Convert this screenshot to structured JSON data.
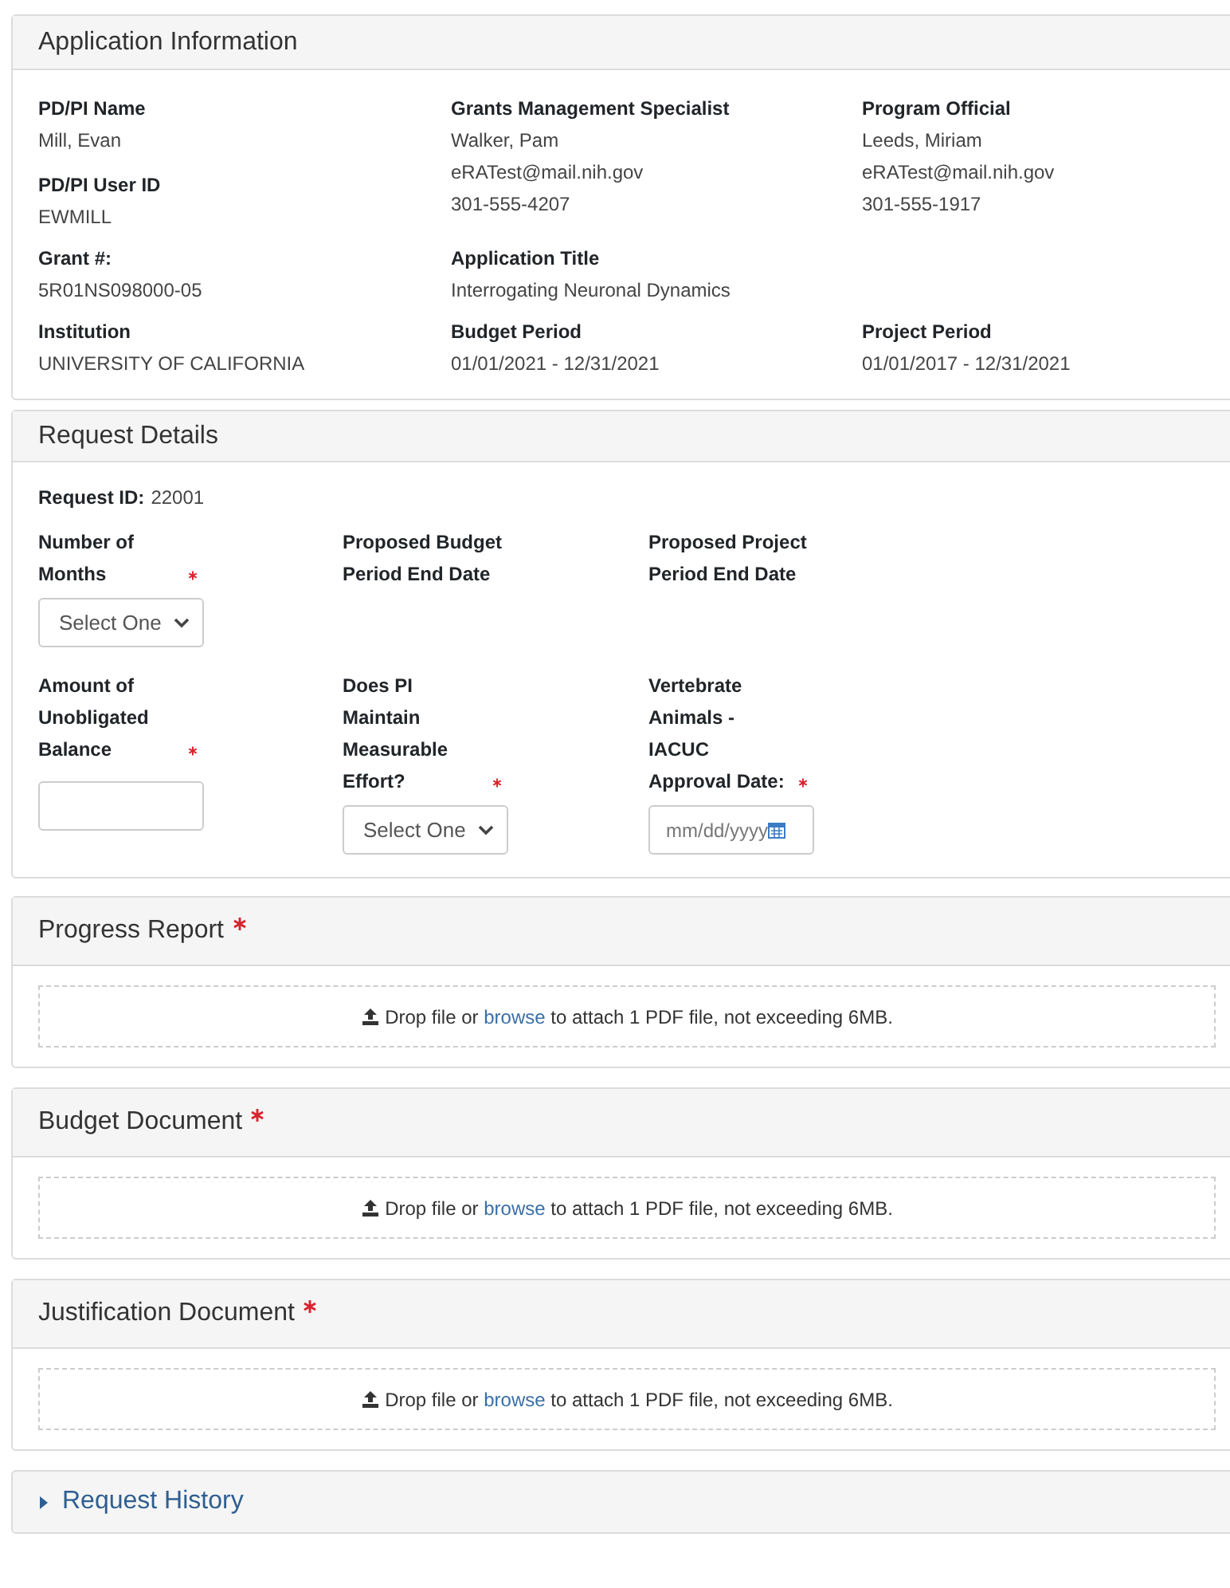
{
  "application_information": {
    "title": "Application Information",
    "rows": [
      [
        [
          {
            "label": "PD/PI Name",
            "values": [
              "Mill, Evan"
            ]
          },
          {
            "label": "PD/PI User ID",
            "values": [
              "EWMILL"
            ]
          }
        ],
        [
          {
            "label": "Grants Management Specialist",
            "values": [
              "Walker, Pam",
              "eRATest@mail.nih.gov",
              "301-555-4207"
            ]
          }
        ],
        [
          {
            "label": "Program Official",
            "values": [
              "Leeds, Miriam",
              "eRATest@mail.nih.gov",
              "301-555-1917"
            ]
          }
        ]
      ],
      [
        [
          {
            "label": "Grant #:",
            "values": [
              "5R01NS098000-05"
            ]
          }
        ],
        [
          {
            "label": "Application Title",
            "values": [
              "Interrogating Neuronal Dynamics"
            ]
          }
        ],
        []
      ],
      [
        [
          {
            "label": "Institution",
            "values": [
              "UNIVERSITY OF CALIFORNIA"
            ]
          }
        ],
        [
          {
            "label": "Budget Period",
            "values": [
              "01/01/2021 - 12/31/2021"
            ]
          }
        ],
        [
          {
            "label": "Project Period",
            "values": [
              "01/01/2017 - 12/31/2021"
            ]
          }
        ]
      ]
    ]
  },
  "request_details": {
    "title": "Request Details",
    "request_id_label": "Request ID:",
    "request_id": "22001",
    "rows": [
      [
        {
          "kind": "select",
          "label": "Number of Months",
          "required": true,
          "placeholder": "Select One"
        },
        {
          "kind": "none",
          "label": "Proposed Budget Period End Date",
          "required": false
        },
        {
          "kind": "none",
          "label": "Proposed Project Period End Date",
          "required": false
        }
      ],
      [
        {
          "kind": "text",
          "label": "Amount of Unobligated Balance",
          "required": true
        },
        {
          "kind": "select",
          "label": "Does PI Maintain Measurable Effort?",
          "required": true,
          "placeholder": "Select One"
        },
        {
          "kind": "date",
          "label": "Vertebrate Animals - IACUC Approval Date:",
          "required": true,
          "placeholder": "mm/dd/yyyy"
        }
      ]
    ]
  },
  "uploads": [
    {
      "title": "Progress Report",
      "required": true,
      "text_before": "Drop file or",
      "link": "browse",
      "text_after": "to attach 1 PDF file, not exceeding 6MB."
    },
    {
      "title": "Budget Document",
      "required": true,
      "text_before": "Drop file or",
      "link": "browse",
      "text_after": "to attach 1 PDF file, not exceeding 6MB."
    },
    {
      "title": "Justification Document",
      "required": true,
      "text_before": "Drop file or",
      "link": "browse",
      "text_after": "to attach 1 PDF file, not exceeding 6MB."
    }
  ],
  "request_history": {
    "title": "Request History",
    "expanded": false
  }
}
